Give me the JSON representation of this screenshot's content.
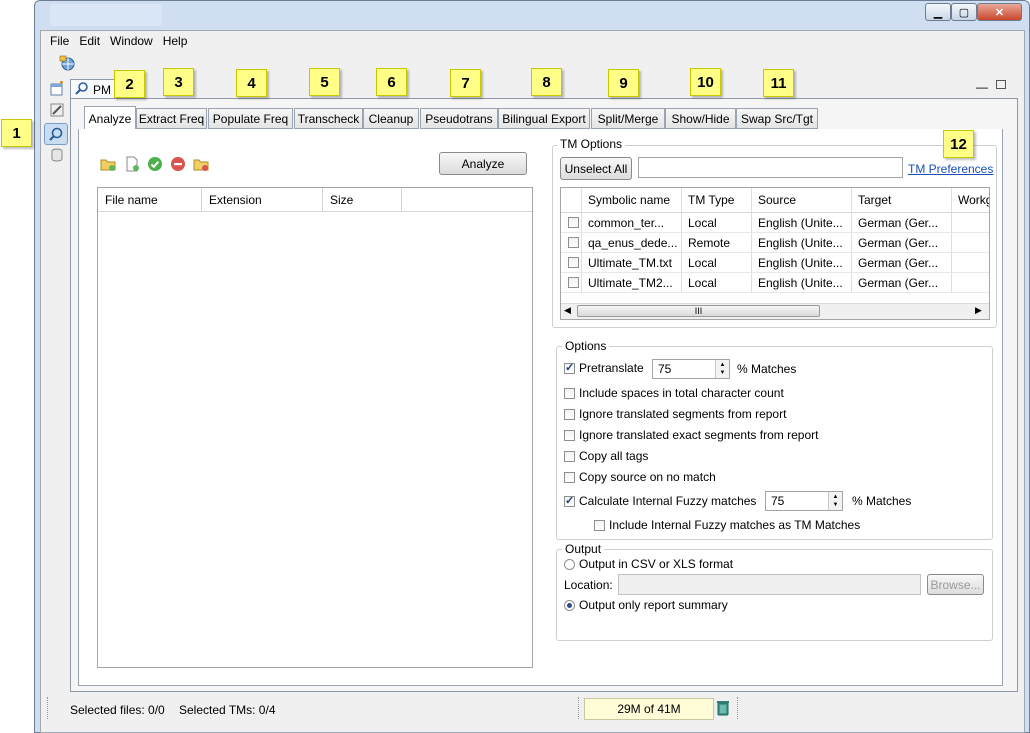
{
  "menu": [
    "File",
    "Edit",
    "Window",
    "Help"
  ],
  "pm_view": {
    "title": "PM"
  },
  "callouts": [
    "1",
    "2",
    "3",
    "4",
    "5",
    "6",
    "7",
    "8",
    "9",
    "10",
    "11",
    "12"
  ],
  "tabs": [
    "Analyze",
    "Extract Freq",
    "Populate Freq",
    "Transcheck",
    "Cleanup",
    "Pseudotrans",
    "Bilingual Export",
    "Split/Merge",
    "Show/Hide",
    "Swap Src/Tgt"
  ],
  "analyze_button": "Analyze",
  "file_table": {
    "columns": [
      "File name",
      "Extension",
      "Size"
    ]
  },
  "tm_options": {
    "legend": "TM Options",
    "unselect_all": "Unselect All",
    "filter_value": "",
    "prefs_link": "TM Preferences",
    "columns": [
      "Symbolic name",
      "TM Type",
      "Source",
      "Target",
      "Workg"
    ],
    "rows": [
      {
        "name": "common_ter...",
        "type": "Local",
        "source": "English (Unite...",
        "target": "German (Ger..."
      },
      {
        "name": "qa_enus_dede...",
        "type": "Remote",
        "source": "English (Unite...",
        "target": "German (Ger..."
      },
      {
        "name": "Ultimate_TM.txt",
        "type": "Local",
        "source": "English (Unite...",
        "target": "German (Ger..."
      },
      {
        "name": "Ultimate_TM2...",
        "type": "Local",
        "source": "English (Unite...",
        "target": "German (Ger..."
      }
    ],
    "scroll_grip": "III"
  },
  "options": {
    "legend": "Options",
    "pretranslate": {
      "label": "Pretranslate",
      "checked": true,
      "value": "75",
      "suffix": "% Matches"
    },
    "include_spaces": {
      "label": "Include spaces in total character count",
      "checked": false
    },
    "ignore_translated": {
      "label": "Ignore translated segments from report",
      "checked": false
    },
    "ignore_exact": {
      "label": "Ignore translated exact segments from report",
      "checked": false
    },
    "copy_tags": {
      "label": "Copy all tags",
      "checked": false
    },
    "copy_source": {
      "label": "Copy source on no match",
      "checked": false
    },
    "internal_fuzzy": {
      "label": "Calculate Internal Fuzzy matches",
      "checked": true,
      "value": "75",
      "suffix": "% Matches"
    },
    "include_internal": {
      "label": "Include Internal Fuzzy matches as TM Matches",
      "checked": false
    }
  },
  "output": {
    "legend": "Output",
    "csv_label": "Output in CSV or XLS format",
    "location_label": "Location:",
    "location_value": "",
    "browse": "Browse...",
    "summary_label": "Output only report summary",
    "selected": "summary"
  },
  "status": {
    "selected_files": "Selected files: 0/0",
    "selected_tms": "Selected TMs: 0/4",
    "memory": "29M of 41M"
  },
  "colors": {
    "callout": "#ffff88",
    "link": "#1a4fb5",
    "window_frame": "#cfdff1",
    "close_button": "#c9462c"
  }
}
